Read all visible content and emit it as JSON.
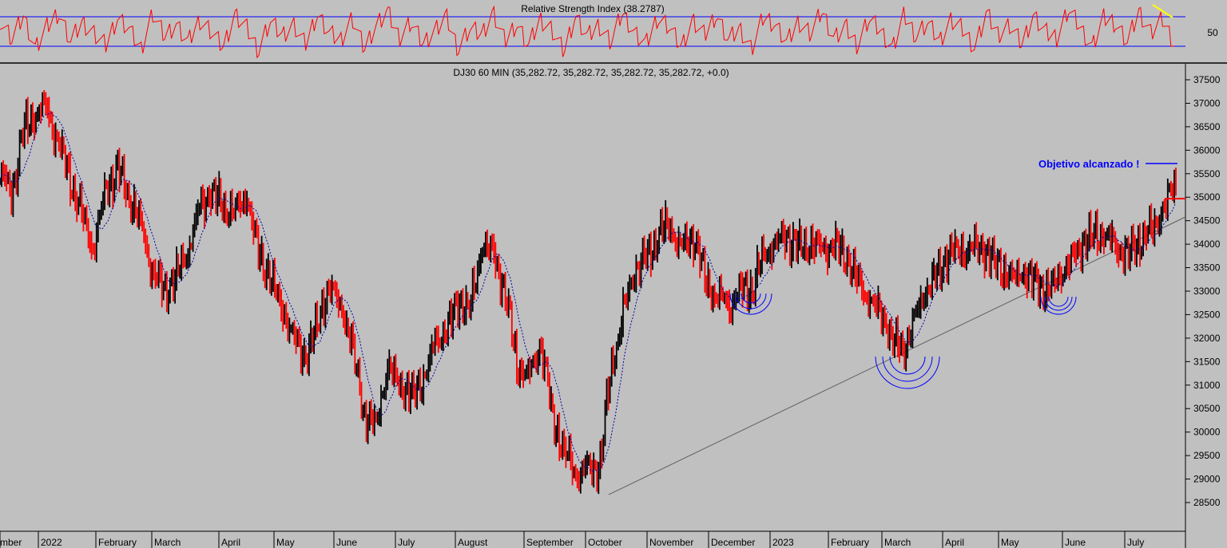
{
  "chart_data": [
    {
      "type": "line",
      "title": "Relative Strength Index (38.2787)",
      "ylabel": "",
      "yticks": [
        "50"
      ],
      "reference_lines": [
        70,
        30
      ],
      "ylim": [
        15,
        85
      ],
      "series": [
        {
          "values": [
            63,
            41,
            68,
            29,
            55,
            72,
            38,
            60,
            47,
            33,
            66,
            52,
            28,
            71,
            44,
            58,
            36,
            63,
            49,
            31,
            69,
            54,
            27,
            62,
            45,
            57,
            34,
            70,
            48,
            39,
            65,
            30,
            56,
            73,
            42,
            61,
            35,
            50,
            67,
            29,
            53,
            46,
            71,
            38,
            59,
            32,
            64,
            51,
            26,
            68,
            43,
            57,
            37,
            72,
            48,
            34,
            66,
            55,
            31,
            62,
            45,
            70,
            39,
            53,
            28,
            67,
            58,
            36,
            61,
            47,
            74,
            41,
            55,
            33,
            65,
            50,
            29,
            69,
            44,
            60,
            38,
            63,
            52,
            30,
            71,
            46,
            57,
            35,
            68,
            49,
            42,
            76,
            54,
            31,
            66,
            59,
            37,
            73,
            48,
            64,
            35
          ]
        }
      ]
    },
    {
      "type": "line",
      "title": "DJ30 60 MIN (35,282.72, 35,282.72, 35,282.72, 35,282.72, +0.0)",
      "xlabel": "",
      "ylabel": "",
      "ylim": [
        28000,
        38000
      ],
      "yticks": [
        "37500",
        "37000",
        "36500",
        "36000",
        "35500",
        "35000",
        "34500",
        "34000",
        "33500",
        "33000",
        "32500",
        "32000",
        "31500",
        "31000",
        "30500",
        "30000",
        "29500",
        "29000",
        "28500"
      ],
      "x_labels": [
        "mber",
        "2022",
        "February",
        "March",
        "April",
        "May",
        "June",
        "July",
        "August",
        "September",
        "October",
        "November",
        "December",
        "2023",
        "February",
        "March",
        "April",
        "May",
        "June",
        "July"
      ],
      "series": [
        {
          "values": [
            35500,
            35100,
            36400,
            36800,
            36900,
            36100,
            35400,
            34600,
            33900,
            35200,
            35600,
            35000,
            34400,
            33400,
            33000,
            33300,
            33900,
            34800,
            35100,
            34800,
            34700,
            35000,
            33800,
            33300,
            32600,
            32000,
            31600,
            32300,
            33100,
            32700,
            31800,
            30300,
            30200,
            31400,
            31000,
            30800,
            31100,
            31900,
            32200,
            32800,
            32600,
            34000,
            33800,
            32900,
            31400,
            31200,
            31900,
            30300,
            29600,
            29100,
            29200,
            29300,
            31400,
            32500,
            33500,
            33700,
            34200,
            34400,
            33900,
            34200,
            33200,
            32900,
            32700,
            33000,
            33100,
            33800,
            34000,
            34200,
            33900,
            34000,
            33900,
            34000,
            33700,
            33200,
            32800,
            32500,
            31900,
            31800,
            32600,
            33100,
            33500,
            33900,
            33800,
            34000,
            33800,
            33500,
            33300,
            33400,
            33200,
            33000,
            33300,
            33600,
            34000,
            34200,
            34200,
            33900,
            33800,
            34100,
            34300,
            34800,
            35300
          ]
        }
      ],
      "trendline": {
        "from": [
          28650
        ],
        "to": [
          34300
        ]
      },
      "annotations": [
        "Objetivo alcanzado !"
      ],
      "target_level": 35500,
      "support_level": 34700
    }
  ],
  "colors": {
    "background": "#c0c0c0",
    "rsi_line": "#ff0000",
    "rsi_bands": "#0000ff",
    "price_bars_down": "#ff0000",
    "price_bars_up": "#000000",
    "moving_average": "#0000aa",
    "annotation": "#0000ff",
    "trendline": "#606060",
    "pattern_arcs": "#0000ff",
    "highlight": "#ffff00"
  }
}
